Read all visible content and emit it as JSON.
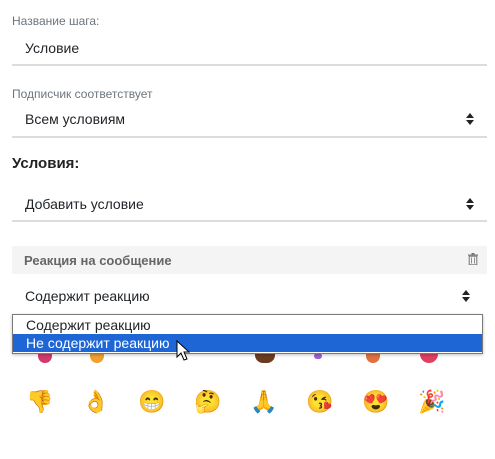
{
  "step_name": {
    "label": "Название шага:",
    "value": "Условие"
  },
  "subscriber_match": {
    "label": "Подписчик соответствует",
    "value": "Всем условиям"
  },
  "conditions": {
    "heading": "Условия:",
    "add_condition": "Добавить условие"
  },
  "reaction_card": {
    "title": "Реакция на сообщение",
    "select_value": "Содержит реакцию",
    "options": [
      "Содержит реакцию",
      "Не содержит реакцию"
    ],
    "selected_index": 1
  },
  "emoji_row_bottom": [
    "👎",
    "👌",
    "😁",
    "🤔",
    "🙏",
    "😘",
    "😍",
    "🎉"
  ],
  "colors": {
    "selection": "#1e66d6",
    "underline": "#dcdcdc",
    "card_bg": "#f4f4f4"
  }
}
